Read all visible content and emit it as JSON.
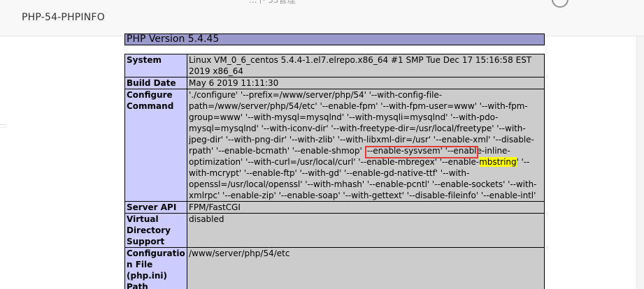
{
  "dialog": {
    "title": "PHP-54-PHPINFO"
  },
  "background": {
    "partial_text": "...卜 55管理"
  },
  "phpinfo": {
    "version_header": "PHP Version 5.4.45",
    "rows": [
      {
        "label": "System",
        "value": "Linux VM_0_6_centos 5.4.4-1.el7.elrepo.x86_64 #1 SMP Tue Dec 17 15:16:58 EST 2019 x86_64"
      },
      {
        "label": "Build Date",
        "value": "May 6 2019 11:11:30"
      },
      {
        "label": "Configure Command",
        "value": ""
      },
      {
        "label": "Server API",
        "value": "FPM/FastCGI"
      },
      {
        "label": "Virtual Directory Support",
        "value": "disabled"
      },
      {
        "label": "Configuration File (php.ini) Path",
        "value": "/www/server/php/54/etc"
      }
    ],
    "configure_command": {
      "before": "'./configure' '--prefix=/www/server/php/54' '--with-config-file-path=/www/server/php/54/etc' '--enable-fpm' '--with-fpm-user=www' '--with-fpm-group=www' '--with-mysql=mysqlnd' '--with-mysqli=mysqlnd' '--with-pdo-mysql=mysqlnd' '--with-iconv-dir' '--with-freetype-dir=/usr/local/freetype' '--with-jpeg-dir' '--with-png-dir' '--with-zlib' '--with-libxml-dir=/usr' '--enable-xml' '--disable-rpath' '--enable-bcmath' '--enable-shmop' '--enable-sysvsem' '--enable-inline-optimization' '--with-curl=/usr/local/curl' '--enable-mbregex' '--enable-",
      "highlight": "mbstring",
      "after": "' '--with-mcrypt' '--enable-ftp' '--with-gd' '--enable-gd-native-ttf' '--with-openssl=/usr/local/openssl' '--with-mhash' '--enable-pcntl' '--enable-sockets' '--with-xmlrpc' '--enable-zip' '--enable-soap' '--with-gettext' '--disable-fileinfo' '--enable-intl'"
    }
  },
  "colors": {
    "header_bg": "#9999cc",
    "label_bg": "#ccccff",
    "value_bg": "#cccccc",
    "highlight": "#ffff00",
    "annotation_border": "#e53935"
  }
}
